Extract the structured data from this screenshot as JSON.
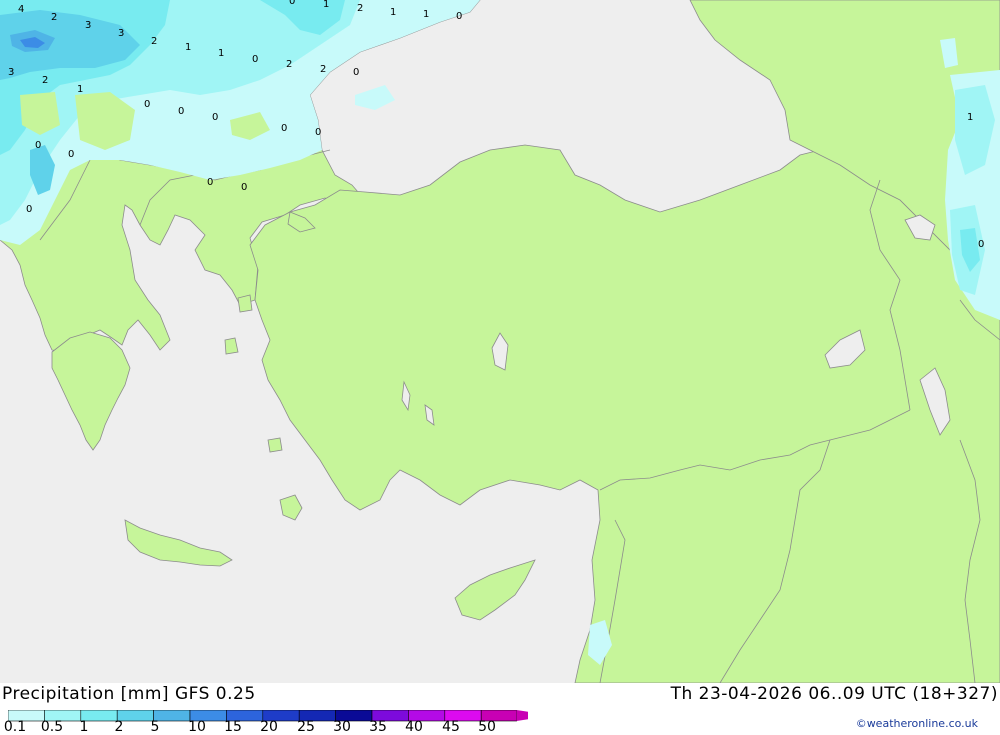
{
  "header": {
    "title": "Precipitation [mm] GFS 0.25",
    "valid_time": "Th 23-04-2026 06..09 UTC (18+327)"
  },
  "legend": {
    "labels": [
      "0.1",
      "0.5",
      "1",
      "2",
      "5",
      "10",
      "15",
      "20",
      "25",
      "30",
      "35",
      "40",
      "45",
      "50"
    ],
    "colors": [
      "#c8fafa",
      "#a0f5f5",
      "#78ebf0",
      "#5fd2ea",
      "#4fb4e6",
      "#3c8ce6",
      "#2d64dc",
      "#1e3cc8",
      "#1428b4",
      "#0a0a96",
      "#7d0adc",
      "#b40ae6",
      "#dc0af0",
      "#c800b4"
    ]
  },
  "map": {
    "colors": {
      "land": "#c6f59a",
      "sea": "#eeeeee",
      "border": "#8c8c8c"
    },
    "value_labels": [
      "4",
      "2",
      "3",
      "3",
      "2",
      "1",
      "1",
      "0",
      "2",
      "2",
      "0",
      "3",
      "2",
      "1",
      "0",
      "0",
      "0",
      "0",
      "0",
      "0",
      "0",
      "0",
      "0",
      "0",
      "1",
      "1",
      "0",
      "0",
      "1",
      "0",
      "2",
      "1",
      "1",
      "0"
    ]
  },
  "credit": "©weatheronline.co.uk"
}
